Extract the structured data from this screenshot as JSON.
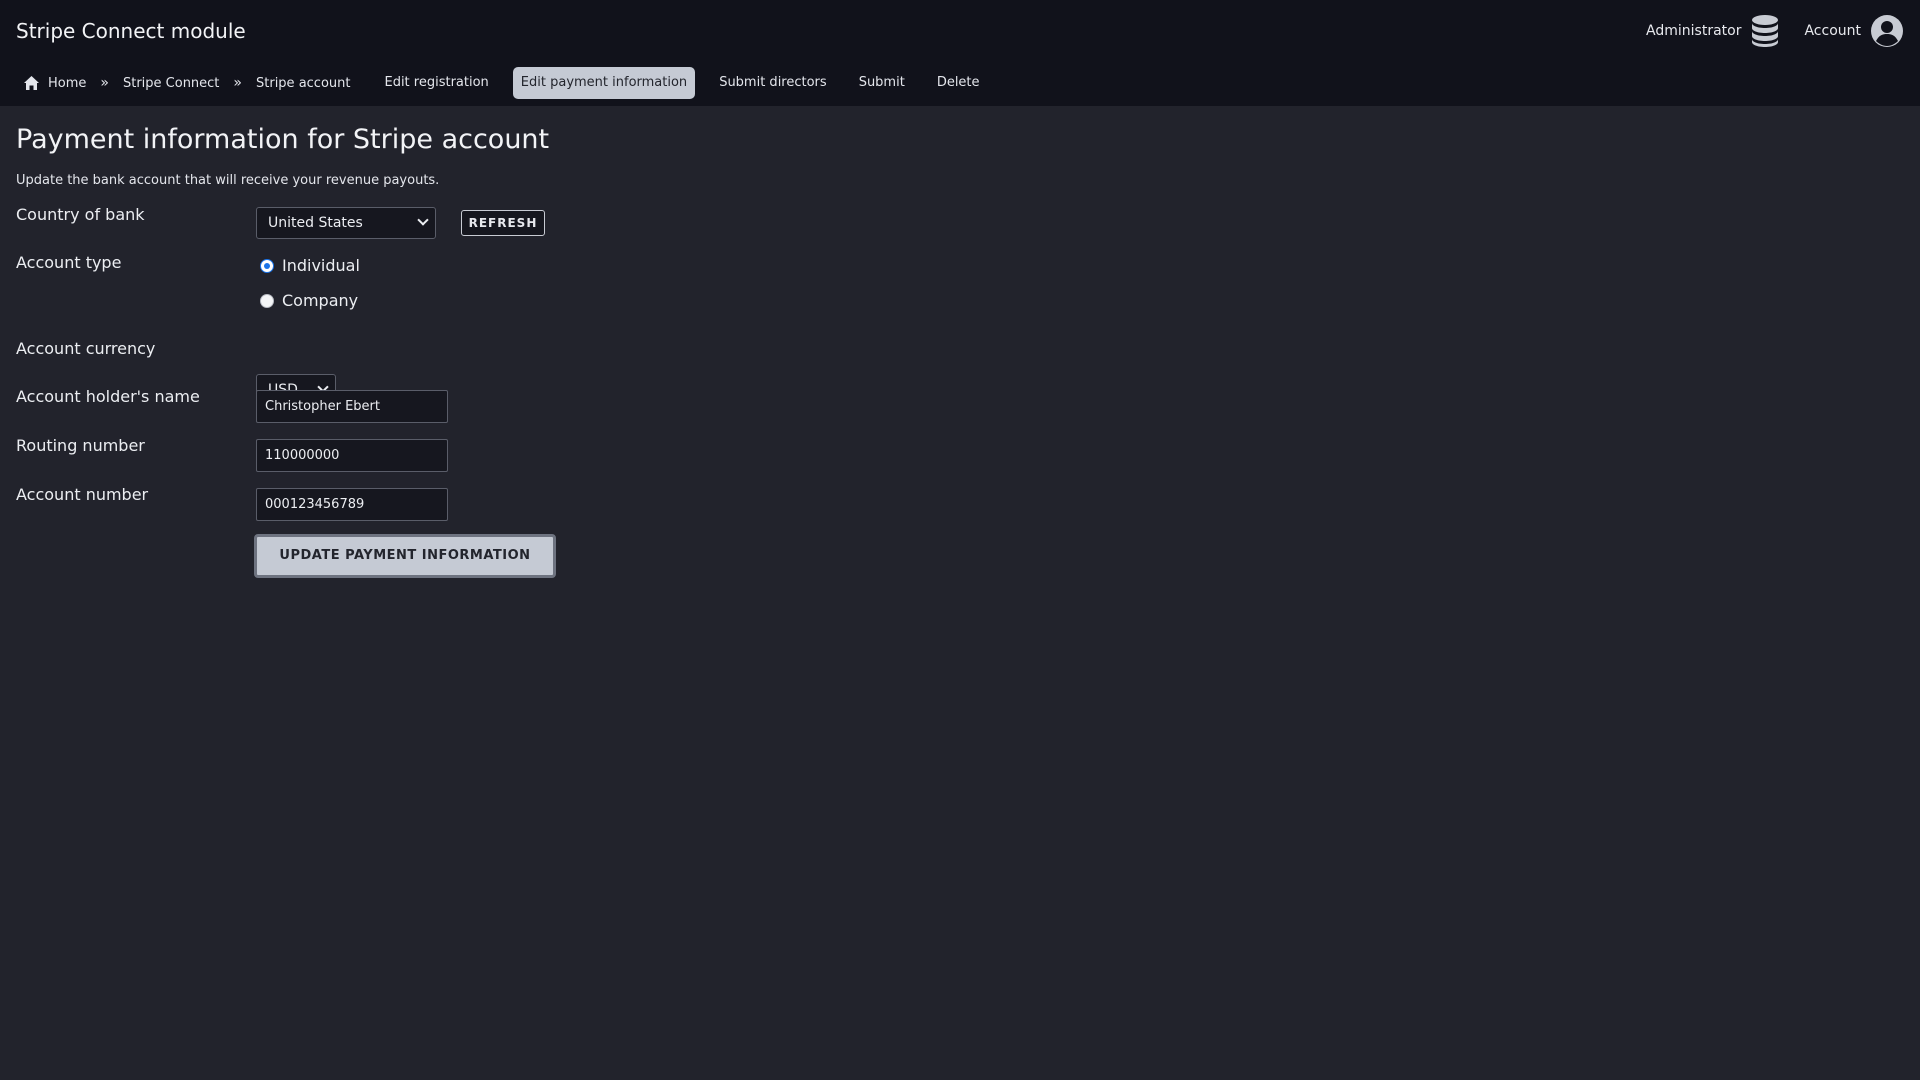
{
  "header": {
    "title": "Stripe Connect module",
    "user_label": "Administrator",
    "account_label": "Account"
  },
  "nav": {
    "breadcrumbs": [
      "Home",
      "Stripe Connect",
      "Stripe account"
    ],
    "separator": "»",
    "tabs": [
      "Edit registration",
      "Edit payment information",
      "Submit directors",
      "Submit",
      "Delete"
    ],
    "active_tab": "Edit payment information"
  },
  "page": {
    "title": "Payment information for Stripe account",
    "description": "Update the bank account that will receive your revenue payouts."
  },
  "form": {
    "country_label": "Country of bank",
    "country_value": "United States",
    "refresh_label": "REFRESH",
    "account_type_label": "Account type",
    "account_type_options": [
      "Individual",
      "Company"
    ],
    "account_type_selected": "Individual",
    "currency_label": "Account currency",
    "currency_value": "USD",
    "holder_label": "Account holder's name",
    "holder_value": "Christopher Ebert",
    "routing_label": "Routing number",
    "routing_value": "110000000",
    "account_number_label": "Account number",
    "account_number_value": "000123456789",
    "submit_label": "UPDATE PAYMENT INFORMATION"
  },
  "colors": {
    "header_bg": "#11121b",
    "page_bg": "#22232c",
    "active_tab_bg": "#c5cad4",
    "radio_accent": "#1a73e8"
  },
  "icons": {
    "home": "home-icon",
    "user": "database-icon",
    "account": "user-circle-icon"
  }
}
